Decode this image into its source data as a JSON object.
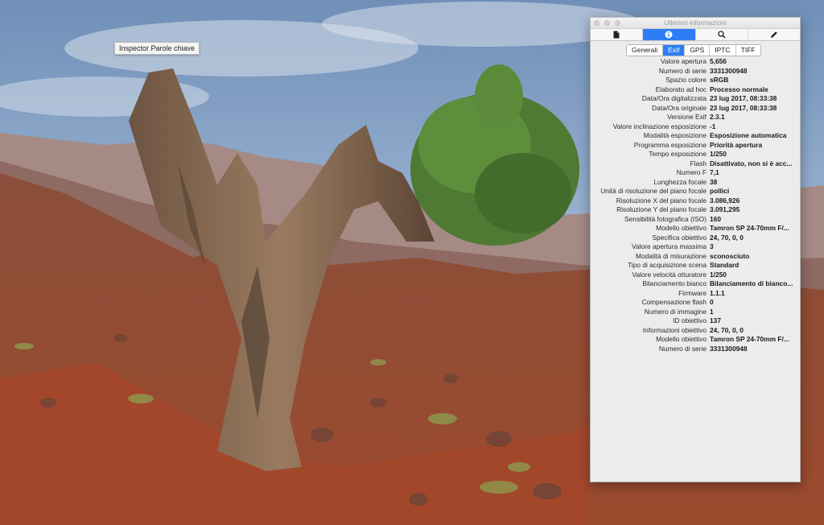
{
  "tooltip": {
    "text": "Inspector Parole chiave"
  },
  "window": {
    "title": "Ulteriori informazioni"
  },
  "toolbar": {
    "buttons": [
      {
        "icon": "document-icon"
      },
      {
        "icon": "info-icon"
      },
      {
        "icon": "search-icon"
      },
      {
        "icon": "pencil-icon"
      }
    ],
    "active": "info-icon"
  },
  "segments": {
    "items": [
      "Generali",
      "Exif",
      "GPS",
      "IPTC",
      "TIFF"
    ],
    "active": "Exif"
  },
  "exif": [
    {
      "label": "Valore apertura",
      "value": "5,656"
    },
    {
      "label": "Numero di serie",
      "value": "3331300948"
    },
    {
      "label": "Spazio colore",
      "value": "sRGB"
    },
    {
      "label": "Elaborato ad hoc",
      "value": "Processo normale"
    },
    {
      "label": "Data/Ora digitalizzata",
      "value": "23 lug 2017, 08:33:38"
    },
    {
      "label": "Data/Ora originale",
      "value": "23 lug 2017, 08:33:38"
    },
    {
      "label": "Versione Exif",
      "value": "2.3.1"
    },
    {
      "label": "Valore inclinazione esposizione",
      "value": "-1"
    },
    {
      "label": "Modalità esposizione",
      "value": "Esposizione automatica"
    },
    {
      "label": "Programma esposizione",
      "value": "Priorità apertura"
    },
    {
      "label": "Tempo esposizione",
      "value": "1/250"
    },
    {
      "label": "Flash",
      "value": "Disattivato, non si è acc..."
    },
    {
      "label": "Numero F",
      "value": "7,1"
    },
    {
      "label": "Lunghezza focale",
      "value": "38"
    },
    {
      "label": "Unità di risoluzione del piano focale",
      "value": "pollici"
    },
    {
      "label": "Risoluzione X del piano focale",
      "value": "3.086,926"
    },
    {
      "label": "Risoluzione Y del piano focale",
      "value": "3.091,295"
    },
    {
      "label": "Sensibilità fotografica (ISO)",
      "value": "160"
    },
    {
      "label": "Modello obiettivo",
      "value": "Tamron SP 24-70mm F/..."
    },
    {
      "label": "Specifica obiettivo",
      "value": "24, 70, 0, 0"
    },
    {
      "label": "Valore apertura massima",
      "value": "3"
    },
    {
      "label": "Modalità di misurazione",
      "value": "sconosciuto"
    },
    {
      "label": "Tipo di acquisizione scena",
      "value": "Standard"
    },
    {
      "label": "Valore velocità otturatore",
      "value": "1/250"
    },
    {
      "label": "Bilanciamento bianco",
      "value": "Bilanciamento di bianco..."
    },
    {
      "label": "Firmware",
      "value": "1.1.1"
    },
    {
      "label": "Compensazione flash",
      "value": "0"
    },
    {
      "label": "Numero di immagine",
      "value": "1"
    },
    {
      "label": "ID obiettivo",
      "value": "137"
    },
    {
      "label": "Informazioni obiettivo",
      "value": "24, 70, 0, 0"
    },
    {
      "label": "Modello obiettivo",
      "value": "Tamron SP 24-70mm F/..."
    },
    {
      "label": "Numero di serie",
      "value": "3331300948"
    }
  ]
}
